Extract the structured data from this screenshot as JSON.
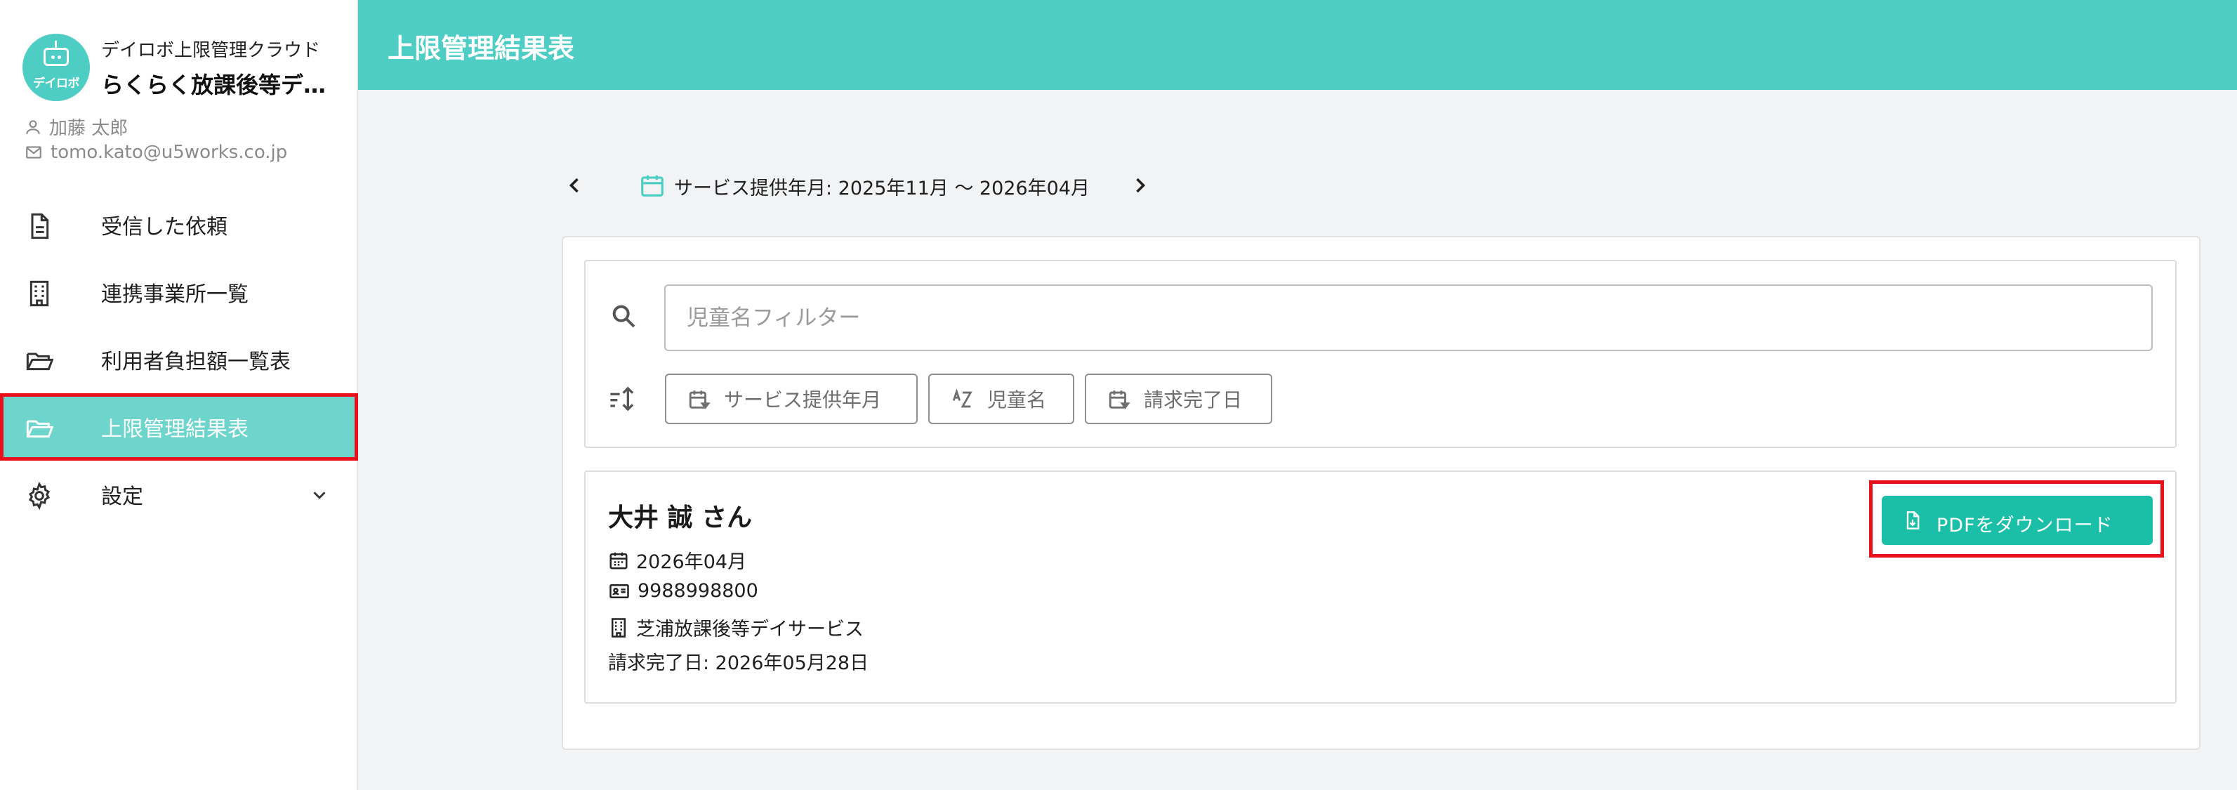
{
  "app": {
    "logo_text": "デイロボ",
    "subtitle": "デイロボ上限管理クラウド",
    "facility_name": "らくらく放課後等デイサービス",
    "user_name": "加藤 太郎",
    "user_email": "tomo.kato@u5works.co.jp"
  },
  "sidebar": {
    "items": [
      {
        "label": "受信した依頼",
        "icon": "document-icon",
        "active": false
      },
      {
        "label": "連携事業所一覧",
        "icon": "building-icon",
        "active": false
      },
      {
        "label": "利用者負担額一覧表",
        "icon": "folder-icon",
        "active": false
      },
      {
        "label": "上限管理結果表",
        "icon": "folder-icon",
        "active": true
      },
      {
        "label": "設定",
        "icon": "gear-icon",
        "active": false
      }
    ]
  },
  "header": {
    "title": "上限管理結果表"
  },
  "period": {
    "label": "サービス提供年月: 2025年11月 〜 2026年04月"
  },
  "filter": {
    "placeholder": "児童名フィルター",
    "sort_buttons": [
      "サービス提供年月",
      "児童名",
      "請求完了日"
    ]
  },
  "result": {
    "child_name": "大井 誠 さん",
    "service_month": "2026年04月",
    "recipient_number": "9988998800",
    "facility": "芝浦放課後等デイサービス",
    "billing_complete": "請求完了日: 2026年05月28日",
    "download_label": "PDFをダウンロード"
  },
  "colors": {
    "accent": "#4ecdc4",
    "active_nav": "#6dd5cb",
    "button": "#1bbfa8",
    "highlight": "#e8101a"
  }
}
